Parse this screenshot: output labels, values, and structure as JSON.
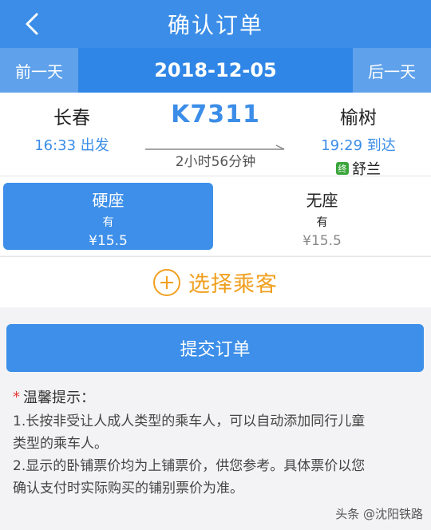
{
  "header": {
    "title": "确认订单",
    "back_icon": "chevron-left-icon"
  },
  "date_bar": {
    "prev_label": "前一天",
    "date": "2018-12-05",
    "next_label": "后一天"
  },
  "train": {
    "from": {
      "name": "长春",
      "time": "16:33 出发"
    },
    "number": "K7311",
    "duration": "2小时56分钟",
    "to": {
      "name": "榆树",
      "time": "19:29 到达"
    },
    "terminal_badge": "终",
    "terminal_name": "舒兰"
  },
  "seats": [
    {
      "name": "硬座",
      "availability": "有",
      "price": "¥15.5",
      "selected": true
    },
    {
      "name": "无座",
      "availability": "有",
      "price": "¥15.5",
      "selected": false
    }
  ],
  "passenger": {
    "label": "选择乘客"
  },
  "submit": {
    "label": "提交订单"
  },
  "tips": {
    "title": "温馨提示：",
    "lines": [
      "1.长按非受让人成人类型的乘车人，可以自动添加同行儿童",
      "类型的乘车人。",
      "2.显示的卧铺票价均为上铺票价，供您参考。具体票价以您",
      "确认支付时实际购买的铺别票价为准。"
    ]
  },
  "watermark": "头条 @沈阳铁路",
  "colors": {
    "primary": "#3b8de8",
    "accent": "#f0a020",
    "terminal_badge": "#3aa53a"
  }
}
